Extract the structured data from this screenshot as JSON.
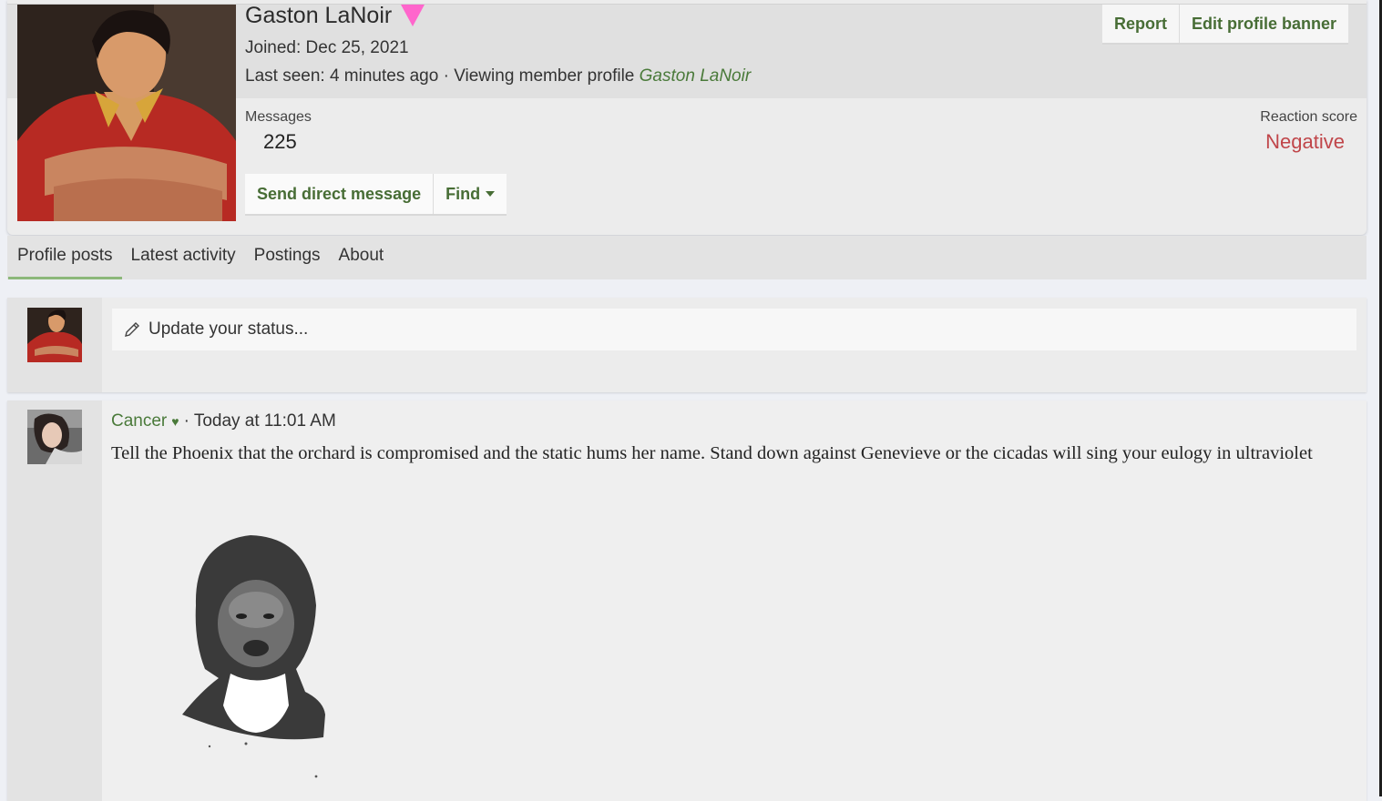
{
  "profile": {
    "name": "Gaston LaNoir",
    "joined": "Joined: Dec 25, 2021",
    "last_seen_prefix": "Last seen: 4 minutes ago · Viewing member profile",
    "last_seen_name": "Gaston LaNoir",
    "messages_label": "Messages",
    "messages_value": "225",
    "reaction_label": "Reaction score",
    "reaction_value": "Negative"
  },
  "header_actions": {
    "report": "Report",
    "edit_banner": "Edit profile banner"
  },
  "member_actions": {
    "send_message": "Send direct message",
    "find": "Find"
  },
  "tabs": [
    {
      "label": "Profile posts"
    },
    {
      "label": "Latest activity"
    },
    {
      "label": "Postings"
    },
    {
      "label": "About"
    }
  ],
  "composer": {
    "placeholder": "Update your status..."
  },
  "post": {
    "author": "Cancer",
    "time": "· Today at 11:01 AM",
    "body": "Tell the Phoenix that the orchard is compromised and the static hums her name. Stand down against Genevieve or the cicadas will sing your eulogy in ultraviolet"
  },
  "colors": {
    "accent_green": "#476d35",
    "negative_red": "#c0464a",
    "badge_pink": "#ff66cc"
  }
}
